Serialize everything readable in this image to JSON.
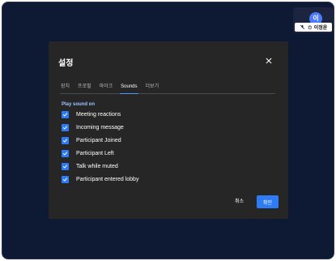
{
  "participant": {
    "avatar_initials": "이",
    "name": "이정윤"
  },
  "dialog": {
    "title": "설정",
    "tabs": [
      {
        "label": "장치",
        "active": false
      },
      {
        "label": "프로필",
        "active": false
      },
      {
        "label": "마이크",
        "active": false
      },
      {
        "label": "Sounds",
        "active": true
      },
      {
        "label": "더보기",
        "active": false
      }
    ],
    "section_label": "Play sound on",
    "options": [
      {
        "label": "Meeting reactions",
        "checked": true
      },
      {
        "label": "Incoming message",
        "checked": true
      },
      {
        "label": "Participant Joined",
        "checked": true
      },
      {
        "label": "Participant Left",
        "checked": true
      },
      {
        "label": "Talk while muted",
        "checked": true
      },
      {
        "label": "Participant entered lobby",
        "checked": true
      }
    ],
    "cancel_label": "취소",
    "ok_label": "확인"
  },
  "colors": {
    "background": "#0e1a33",
    "dialog": "#262626",
    "accent": "#2d7cf6",
    "section_label": "#9ec4ff"
  },
  "icons": {
    "close": "close-icon",
    "checkbox": "check-icon",
    "mic_muted": "mic-off-icon",
    "hand": "hand-icon"
  }
}
